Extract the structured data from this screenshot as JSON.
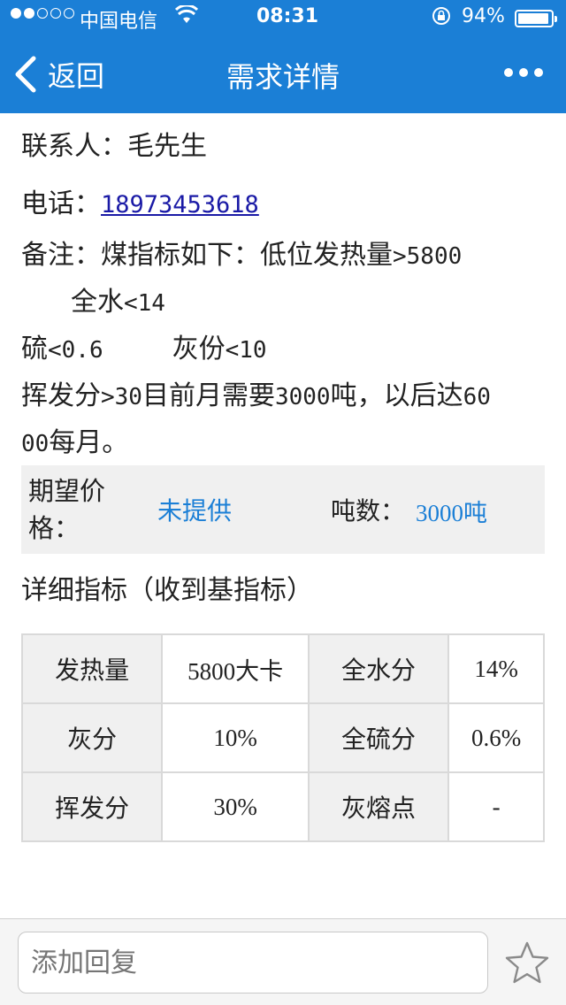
{
  "status": {
    "carrier": "中国电信",
    "time": "08:31",
    "battery_pct": "94%",
    "battery_level": 0.94
  },
  "nav": {
    "back_label": "返回",
    "title": "需求详情",
    "more_icon": "more-dots-icon"
  },
  "detail": {
    "contact_label": "联系人：",
    "contact_value": "毛先生",
    "phone_label": "电话：",
    "phone_value": "18973453618",
    "remark_label": "备注：",
    "remark_line1_a": "煤指标如下：低位发热量",
    "remark_line1_b": ">5800",
    "remark_line2_a": "全水",
    "remark_line2_b": "<14",
    "remark_line3_a": "硫",
    "remark_line3_b": "<0.6",
    "remark_line3_c": "灰份",
    "remark_line3_d": "<10",
    "remark_line4_a": "挥发分",
    "remark_line4_b": ">30",
    "remark_line4_c": "目前月需要",
    "remark_line4_d": "3000",
    "remark_line4_e": "吨，以后达",
    "remark_line4_f": "60",
    "remark_line5_a": "00",
    "remark_line5_b": "每月。"
  },
  "price_box": {
    "price_label": "期望价格：",
    "price_value": "未提供",
    "tons_label": "吨数：",
    "tons_value": "3000吨"
  },
  "specs": {
    "title": "详细指标（收到基指标）",
    "rows": [
      {
        "k1": "发热量",
        "v1": "5800大卡",
        "k2": "全水分",
        "v2": "14%"
      },
      {
        "k1": "灰分",
        "v1": "10%",
        "k2": "全硫分",
        "v2": "0.6%"
      },
      {
        "k1": "挥发分",
        "v1": "30%",
        "k2": "灰熔点",
        "v2": "-"
      }
    ]
  },
  "reply": {
    "placeholder": "添加回复",
    "favorite_icon": "star-icon"
  },
  "colors": {
    "brand_blue": "#1b7fd6",
    "link_blue": "#1a1aa6",
    "table_header_bg": "#f0f0f0"
  }
}
